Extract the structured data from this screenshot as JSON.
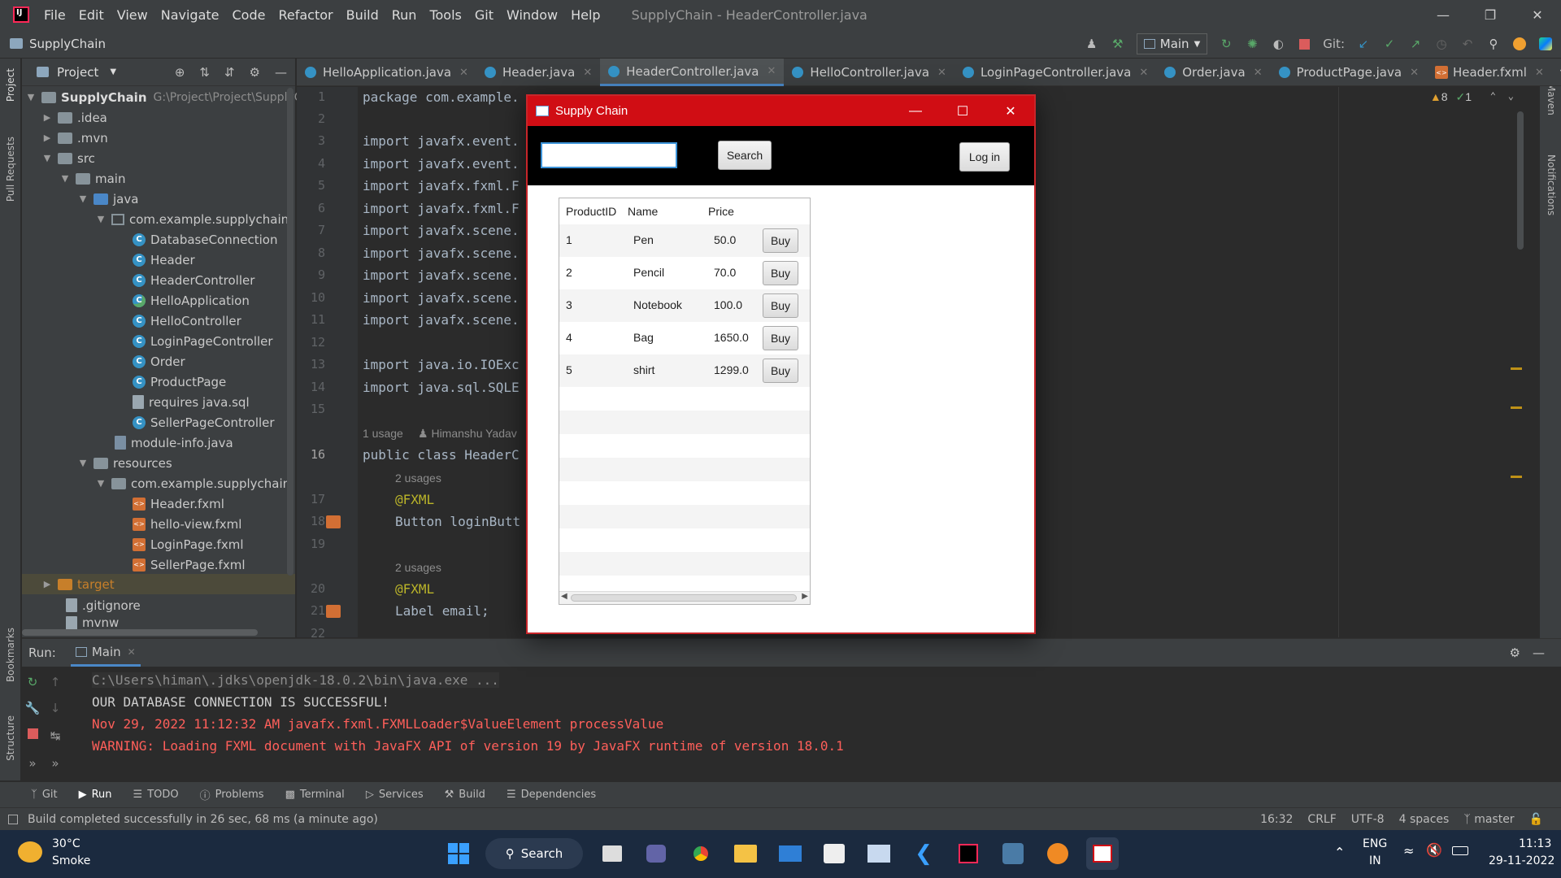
{
  "menubar": {
    "items": [
      "File",
      "Edit",
      "View",
      "Navigate",
      "Code",
      "Refactor",
      "Build",
      "Run",
      "Tools",
      "Git",
      "Window",
      "Help"
    ],
    "window_title": "SupplyChain - HeaderController.java"
  },
  "toolbar": {
    "project_name": "SupplyChain",
    "run_config": "Main",
    "git_label": "Git:"
  },
  "left_strip": {
    "project": "Project",
    "pull_requests": "Pull Requests",
    "bookmarks": "Bookmarks",
    "structure": "Structure"
  },
  "right_strip": {
    "maven": "Maven",
    "notifications": "Notifications"
  },
  "project_panel": {
    "title": "Project",
    "root_name": "SupplyChain",
    "root_path": "G:\\Project\\Project\\SupplyCha",
    "rows": [
      {
        "label": ".idea"
      },
      {
        "label": ".mvn"
      },
      {
        "label": "src"
      },
      {
        "label": "main"
      },
      {
        "label": "java"
      },
      {
        "label": "com.example.supplychain"
      },
      {
        "label": "DatabaseConnection"
      },
      {
        "label": "Header"
      },
      {
        "label": "HeaderController"
      },
      {
        "label": "HelloApplication"
      },
      {
        "label": "HelloController"
      },
      {
        "label": "LoginPageController"
      },
      {
        "label": "Order"
      },
      {
        "label": "ProductPage"
      },
      {
        "label": "requires java.sql"
      },
      {
        "label": "SellerPageController"
      },
      {
        "label": "module-info.java"
      },
      {
        "label": "resources"
      },
      {
        "label": "com.example.supplychain"
      },
      {
        "label": "Header.fxml"
      },
      {
        "label": "hello-view.fxml"
      },
      {
        "label": "LoginPage.fxml"
      },
      {
        "label": "SellerPage.fxml"
      },
      {
        "label": "target"
      },
      {
        "label": ".gitignore"
      },
      {
        "label": "mvnw"
      }
    ]
  },
  "editor_tabs": [
    "HelloApplication.java",
    "Header.java",
    "HeaderController.java",
    "HelloController.java",
    "LoginPageController.java",
    "Order.java",
    "ProductPage.java",
    "Header.fxml"
  ],
  "editor": {
    "warnings": "8",
    "checks": "1",
    "line_numbers": [
      "1",
      "2",
      "3",
      "4",
      "5",
      "6",
      "7",
      "8",
      "9",
      "10",
      "11",
      "12",
      "13",
      "14",
      "15",
      "16",
      "17",
      "18",
      "19",
      "20",
      "21",
      "22"
    ],
    "lines": {
      "l1": "package com.example.",
      "l3": "import javafx.event.",
      "l4": "import javafx.event.",
      "l5": "import javafx.fxml.F",
      "l6": "import javafx.fxml.F",
      "l7": "import javafx.scene.",
      "l8": "import javafx.scene.",
      "l9": "import javafx.scene.",
      "l10": "import javafx.scene.",
      "l11": "import javafx.scene.",
      "l13": "import java.io.IOExc",
      "l14": "import java.sql.SQLE",
      "usage_hint": "1 usage",
      "author_hint": "Himanshu Yadav",
      "l16": "public class HeaderC",
      "usages_2a": "2 usages",
      "l17": "@FXML",
      "l18": "Button loginButt",
      "usages_2b": "2 usages",
      "l20": "@FXML",
      "l21": "Label email;"
    }
  },
  "run_panel": {
    "run_label": "Run:",
    "tab": "Main",
    "console": [
      "C:\\Users\\himan\\.jdks\\openjdk-18.0.2\\bin\\java.exe ...",
      "OUR DATABASE CONNECTION IS SUCCESSFUL!",
      "Nov 29, 2022 11:12:32 AM javafx.fxml.FXMLLoader$ValueElement processValue",
      "WARNING: Loading FXML document with JavaFX API of version 19 by JavaFX runtime of version 18.0.1"
    ],
    "colors": {
      "gray": "#8c8c8c",
      "white": "#cfcfcf",
      "red": "#ff5f5a"
    }
  },
  "tool_tabs": [
    "Git",
    "Run",
    "TODO",
    "Problems",
    "Terminal",
    "Services",
    "Build",
    "Dependencies"
  ],
  "status_bar": {
    "message": "Build completed successfully in 26 sec, 68 ms (a minute ago)",
    "position": "16:32",
    "line_sep": "CRLF",
    "encoding": "UTF-8",
    "indent": "4 spaces",
    "branch": "master"
  },
  "taskbar": {
    "temp": "30°C",
    "weather": "Smoke",
    "search": "Search",
    "lang1": "ENG",
    "lang2": "IN",
    "time": "11:13",
    "date": "29-11-2022"
  },
  "fx_window": {
    "title": "Supply Chain",
    "search_value": "",
    "search_button": "Search",
    "login_button": "Log in",
    "columns": [
      "ProductID",
      "Name",
      "Price"
    ],
    "buy_label": "Buy",
    "rows": [
      {
        "id": "1",
        "name": "Pen",
        "price": "50.0"
      },
      {
        "id": "2",
        "name": "Pencil",
        "price": "70.0"
      },
      {
        "id": "3",
        "name": "Notebook",
        "price": "100.0"
      },
      {
        "id": "4",
        "name": "Bag",
        "price": "1650.0"
      },
      {
        "id": "5",
        "name": "shirt",
        "price": "1299.0"
      }
    ],
    "accent": "#d00d14"
  }
}
